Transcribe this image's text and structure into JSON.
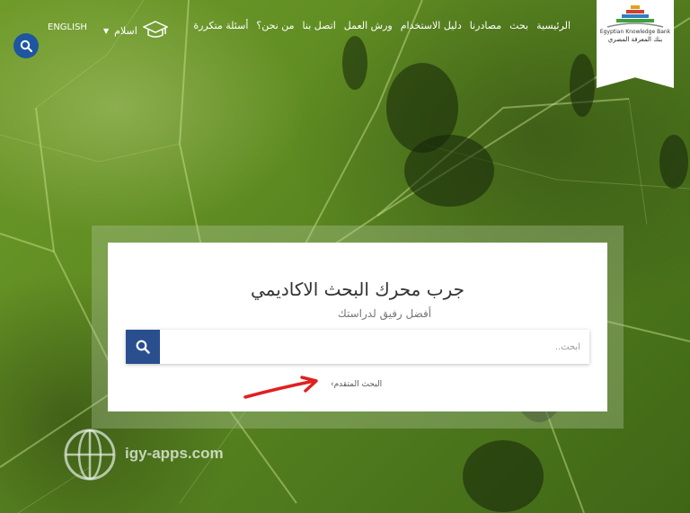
{
  "nav": {
    "items": [
      "الرئيسية",
      "بحث",
      "مصادرنا",
      "دليل الاستخدام",
      "ورش العمل",
      "اتصل بنا",
      "من نحن؟",
      "أسئلة متكررة"
    ],
    "login_label": "اسلام",
    "language_label": "ENGLISH"
  },
  "logo": {
    "line1": "Egyptian Knowledge Bank",
    "line2": "بنك المعرفة المصري"
  },
  "search_card": {
    "title": "جرب محرك البحث الاكاديمي",
    "subtitle": "أفضل رفيق لدراستك",
    "placeholder": "ابحث..",
    "advanced_label": "البحث المتقدم"
  },
  "watermark": {
    "text": "igy-apps.com"
  },
  "colors": {
    "primary_blue": "#1e56a0",
    "search_button": "#2a4f8f",
    "arrow_red": "#e02020"
  }
}
